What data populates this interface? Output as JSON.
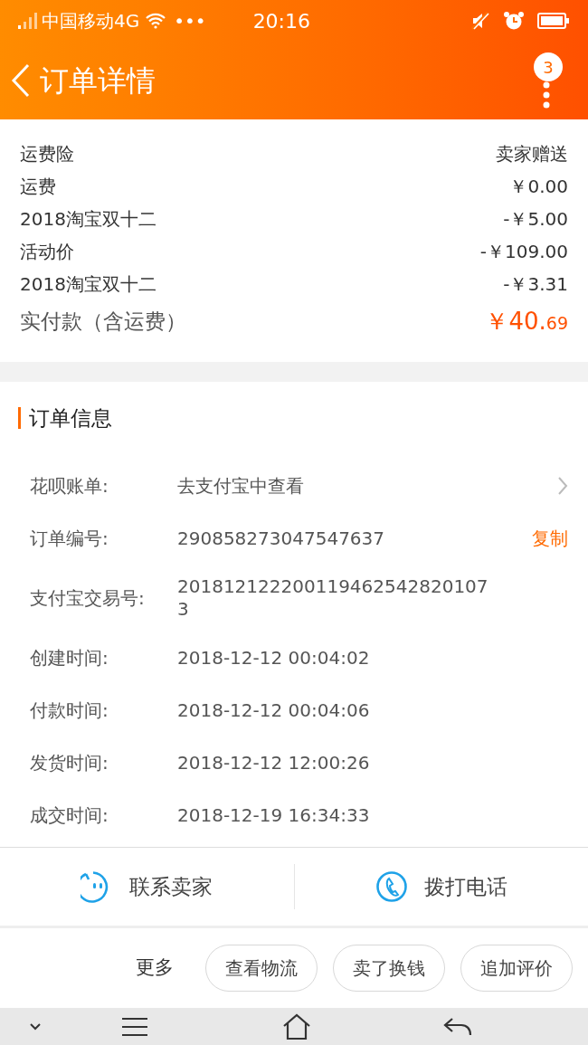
{
  "status_bar": {
    "carrier": "中国移动4G",
    "dots": "•••",
    "time": "20:16"
  },
  "header": {
    "title": "订单详情",
    "badge": "3"
  },
  "price_rows": [
    {
      "label": "运费险",
      "value": "卖家赠送"
    },
    {
      "label": "运费",
      "value": "￥0.00"
    },
    {
      "label": "2018淘宝双十二",
      "value": "-￥5.00"
    },
    {
      "label": "活动价",
      "value": "-￥109.00"
    },
    {
      "label": "2018淘宝双十二",
      "value": "-￥3.31"
    }
  ],
  "total": {
    "label": "实付款（含运费）",
    "value": "￥40.",
    "fraction": "69"
  },
  "order_info": {
    "title": "订单信息",
    "rows": [
      {
        "label": "花呗账单:",
        "value": "去支付宝中查看",
        "kind": "link"
      },
      {
        "label": "订单编号:",
        "value": "290858273047547637",
        "action": "复制",
        "kind": "copy"
      },
      {
        "label": "支付宝交易号:",
        "value": "2018121222001194625428201073",
        "kind": "text"
      },
      {
        "label": "创建时间:",
        "value": "2018-12-12 00:04:02",
        "kind": "text"
      },
      {
        "label": "付款时间:",
        "value": "2018-12-12 00:04:06",
        "kind": "text"
      },
      {
        "label": "发货时间:",
        "value": "2018-12-12 12:00:26",
        "kind": "text"
      },
      {
        "label": "成交时间:",
        "value": "2018-12-19 16:34:33",
        "kind": "text"
      }
    ]
  },
  "contact": {
    "seller": "联系卖家",
    "phone": "拨打电话"
  },
  "more": {
    "label": "更多",
    "buttons": [
      "查看物流",
      "卖了换钱",
      "追加评价"
    ]
  }
}
